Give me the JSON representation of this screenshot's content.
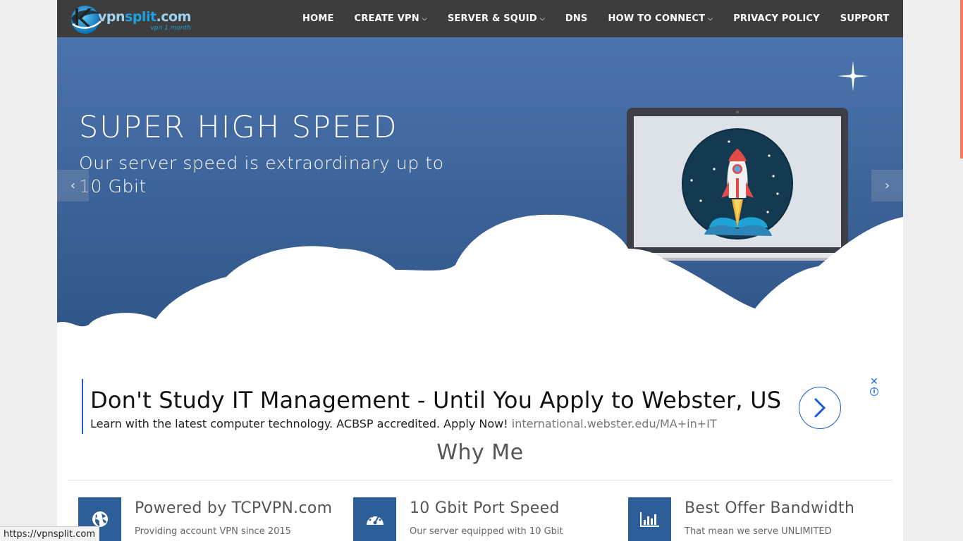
{
  "brand": {
    "name_part1": "vpn",
    "name_part2": "split",
    "name_part3": ".com",
    "tagline": "vpn 1 month"
  },
  "nav": {
    "items": [
      {
        "label": "HOME",
        "has_dropdown": false
      },
      {
        "label": "CREATE VPN",
        "has_dropdown": true
      },
      {
        "label": "SERVER & SQUID",
        "has_dropdown": true
      },
      {
        "label": "DNS",
        "has_dropdown": false
      },
      {
        "label": "HOW TO CONNECT",
        "has_dropdown": true
      },
      {
        "label": "PRIVACY POLICY",
        "has_dropdown": false
      },
      {
        "label": "SUPPORT",
        "has_dropdown": false
      }
    ],
    "caret_glyph": "⌵"
  },
  "hero": {
    "title": "SUPER HIGH SPEED",
    "subtitle": "Our server speed is extraordinary up to 10 Gbit",
    "prev_glyph": "‹",
    "next_glyph": "›"
  },
  "ad": {
    "headline": "Don't Study IT Management - Until You Apply to Webster, US",
    "description": "Learn with the latest computer technology. ACBSP accredited. Apply Now!",
    "url": "international.webster.edu/MA+in+IT",
    "close_glyph": "✕",
    "info_glyph": "i"
  },
  "why": {
    "title": "Why Me",
    "features": [
      {
        "icon": "globe-icon",
        "title": "Powered by TCPVPN.com",
        "desc": "Providing account VPN since 2015"
      },
      {
        "icon": "speedometer-icon",
        "title": "10 Gbit Port Speed",
        "desc": "Our server equipped with 10 Gbit"
      },
      {
        "icon": "bar-chart-icon",
        "title": "Best Offer Bandwidth",
        "desc": "That mean we serve UNLIMITED"
      }
    ]
  },
  "statusbar": {
    "url": "https://vpnsplit.com"
  },
  "colors": {
    "navbar": "#3d3d3d",
    "hero_top": "#4b73ad",
    "hero_bottom": "#2f5587",
    "feature_icon_bg": "#2d5e98",
    "ad_accent": "#1a5bd6"
  }
}
